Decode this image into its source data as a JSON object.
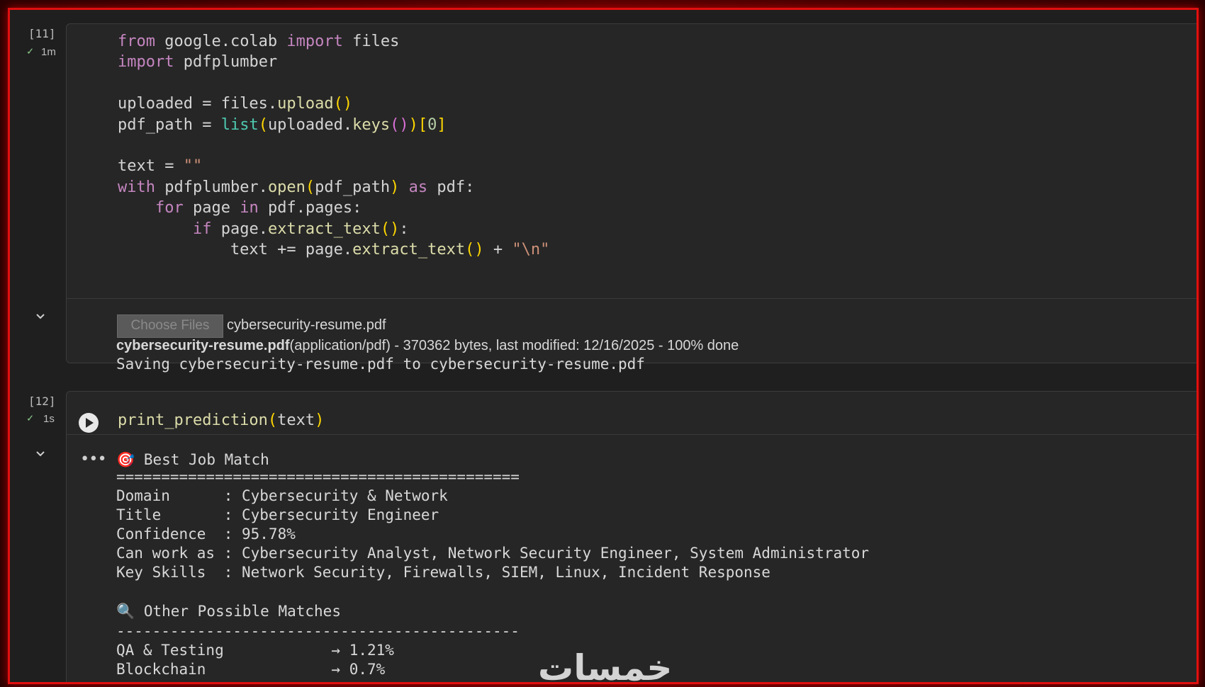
{
  "cell1": {
    "exec_count": "[11]",
    "status_time": "1m",
    "code_lines": [
      "from google.colab import files",
      "import pdfplumber",
      "",
      "uploaded = files.upload()",
      "pdf_path = list(uploaded.keys())[0]",
      "",
      "text = \"\"",
      "with pdfplumber.open(pdf_path) as pdf:",
      "    for page in pdf.pages:",
      "        if page.extract_text():",
      "            text += page.extract_text() + \"\\n\""
    ],
    "output": {
      "choose_files_label": "Choose Files",
      "selected_file": "cybersecurity-resume.pdf",
      "upload_file_name": "cybersecurity-resume.pdf",
      "upload_details": "(application/pdf) - 370362 bytes, last modified: 12/16/2025 - 100% done",
      "saving_line": "Saving cybersecurity-resume.pdf to cybersecurity-resume.pdf"
    }
  },
  "cell2": {
    "exec_count": "[12]",
    "status_time": "1s",
    "code": "print_prediction(text)",
    "output": {
      "best_match_icon": "🎯",
      "best_match_header": "Best Job Match",
      "divider_double": "=============================================",
      "rows": [
        "Domain      : Cybersecurity & Network",
        "Title       : Cybersecurity Engineer",
        "Confidence  : 95.78%",
        "Can work as : Cybersecurity Analyst, Network Security Engineer, System Administrator",
        "Key Skills  : Network Security, Firewalls, SIEM, Linux, Incident Response"
      ],
      "other_icon": "🔍",
      "other_header": "Other Possible Matches",
      "divider_single": "---------------------------------------------",
      "other_matches": [
        "QA & Testing            → 1.21%",
        "Blockchain              → 0.7%"
      ]
    }
  },
  "watermark": "خمسات",
  "colors": {
    "frame": "#e01010",
    "keyword": "#c586c0",
    "function": "#dcdcaa",
    "builtin": "#4ec9b0"
  }
}
